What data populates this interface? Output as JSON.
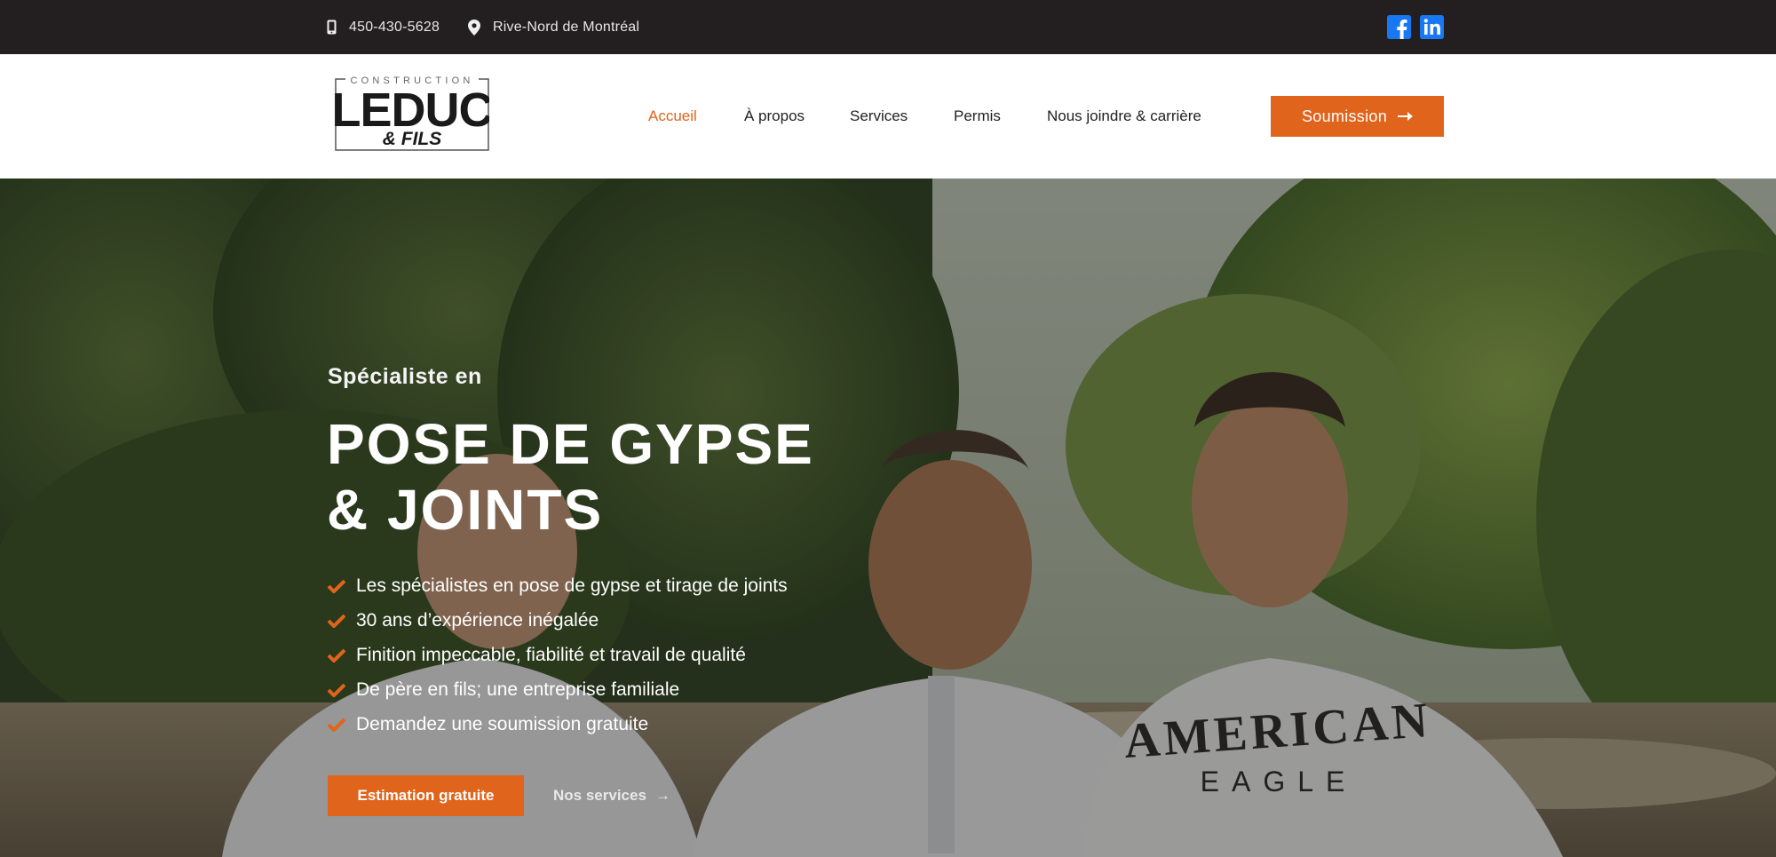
{
  "topbar": {
    "phone": "450-430-5628",
    "location": "Rive-Nord de Montréal",
    "phone_icon": "mobile-phone-icon",
    "location_icon": "map-pin-icon",
    "social": [
      {
        "icon": "facebook-icon",
        "color": "#1877f2"
      },
      {
        "icon": "linkedin-icon",
        "color": "#1877f2"
      }
    ]
  },
  "header": {
    "logo": {
      "top": "CONSTRUCTION",
      "main": "LEDUC",
      "sub": "& FILS"
    },
    "nav": [
      {
        "label": "Accueil",
        "active": true
      },
      {
        "label": "À propos"
      },
      {
        "label": "Services"
      },
      {
        "label": "Permis"
      },
      {
        "label": "Nous joindre & carrière"
      }
    ],
    "cta_label": "Soumission",
    "cta_icon": "arrow-right-icon"
  },
  "hero": {
    "kicker": "Spécialiste en",
    "title_line1": "POSE DE GYPSE",
    "title_line2": "& JOINTS",
    "benefits": [
      "Les spécialistes en pose de gypse et tirage de joints",
      "30 ans d’expérience inégalée",
      "Finition impeccable, fiabilité et travail de qualité",
      "De père en fils; une entreprise familiale",
      "Demandez une soumission gratuite"
    ],
    "primary_button": "Estimation gratuite",
    "secondary_link": "Nos services",
    "secondary_arrow": "→"
  },
  "colors": {
    "accent": "#e0641b",
    "topbar": "#231f20",
    "nav_text": "#222222"
  }
}
